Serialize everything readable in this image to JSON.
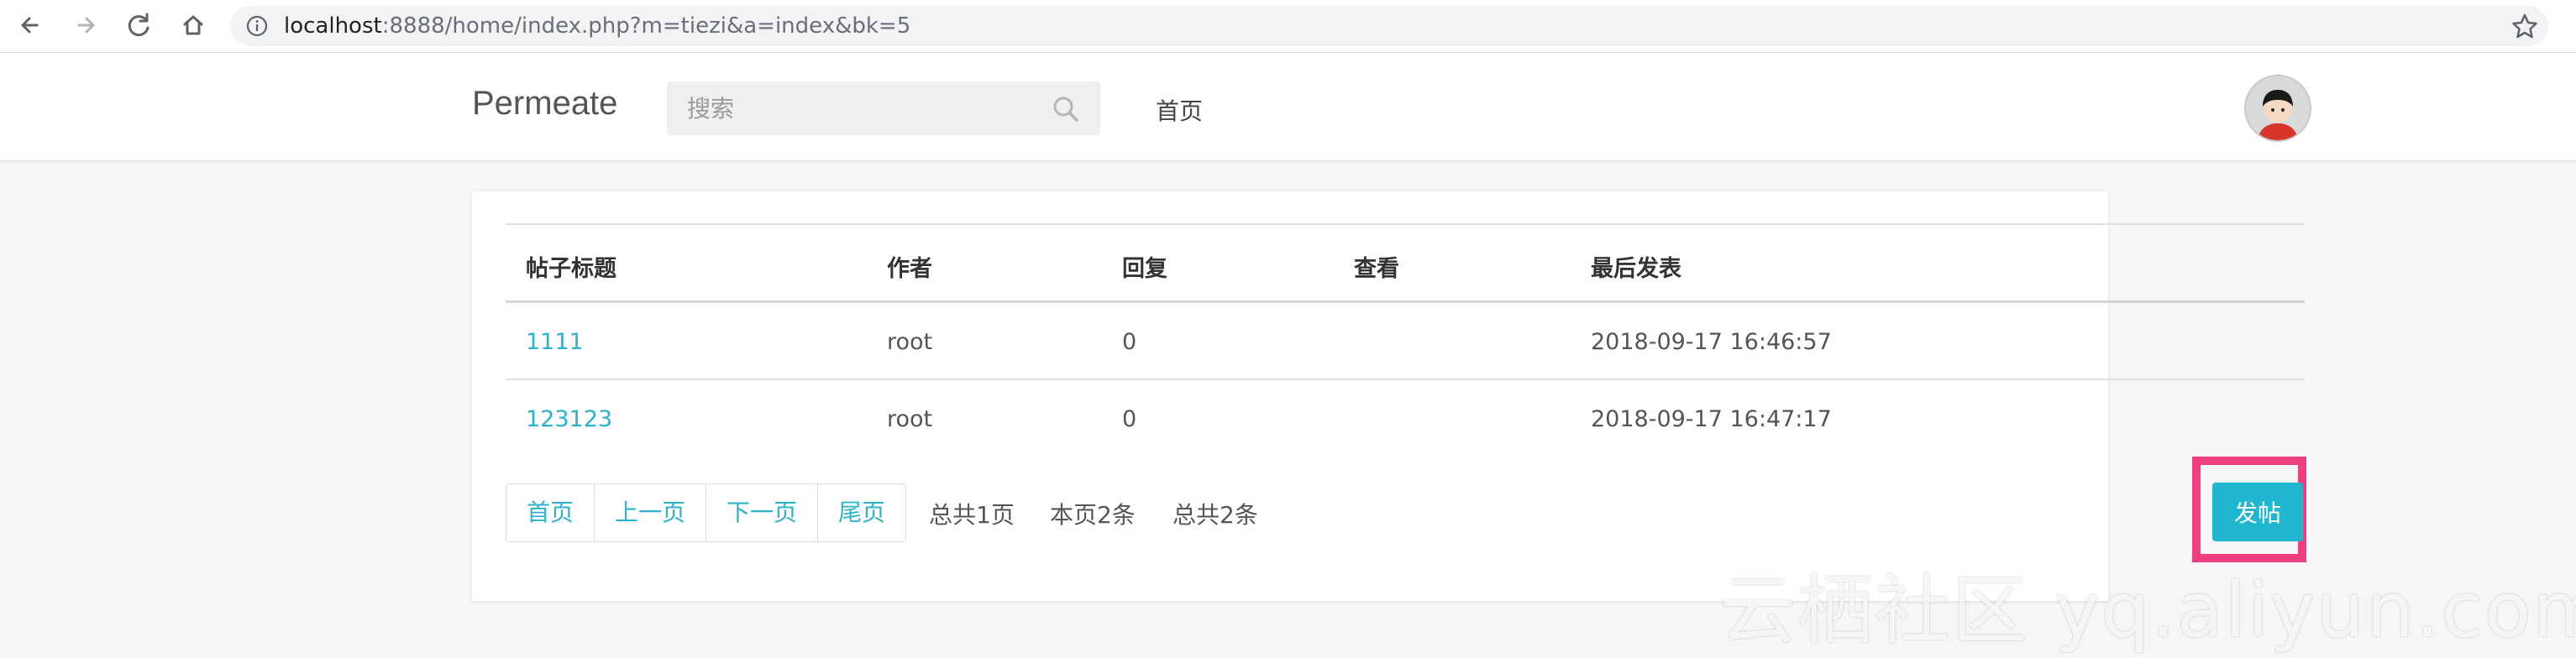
{
  "browser": {
    "url_host": "localhost",
    "url_rest": ":8888/home/index.php?m=tiezi&a=index&bk=5"
  },
  "header": {
    "brand": "Permeate",
    "search_placeholder": "搜索",
    "nav_home": "首页"
  },
  "table": {
    "headers": [
      "帖子标题",
      "作者",
      "回复",
      "查看",
      "最后发表"
    ],
    "rows": [
      {
        "title": "1111",
        "author": "root",
        "replies": "0",
        "views": "",
        "last_post": "2018-09-17 16:46:57"
      },
      {
        "title": "123123",
        "author": "root",
        "replies": "0",
        "views": "",
        "last_post": "2018-09-17 16:47:17"
      }
    ]
  },
  "pagination": {
    "first": "首页",
    "prev": "上一页",
    "next": "下一页",
    "last": "尾页",
    "total_pages": "总共1页",
    "this_page": "本页2条",
    "total_items": "总共2条"
  },
  "actions": {
    "post_button": "发帖"
  },
  "watermark": "云栖社区 yq.aliyun.com",
  "colors": {
    "accent": "#1fb7cf",
    "link": "#2bb4c8",
    "highlight": "#ef3f7e"
  }
}
